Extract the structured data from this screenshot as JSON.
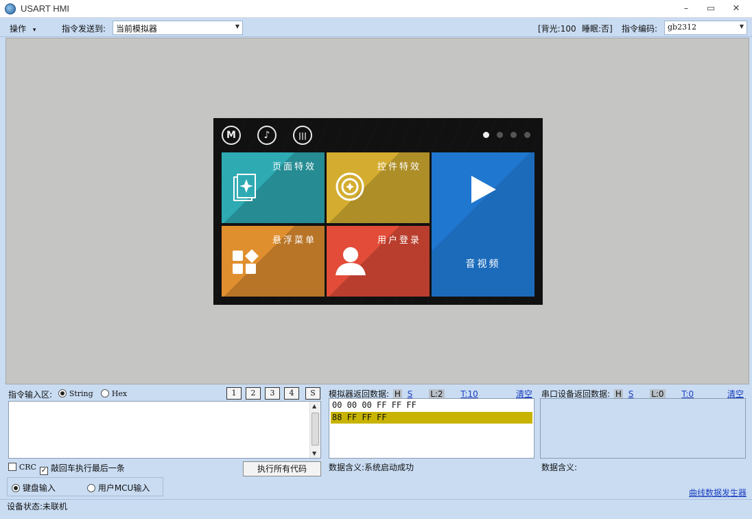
{
  "window": {
    "title": "USART HMI",
    "minimize": "–",
    "maximize": "▭",
    "close": "✕"
  },
  "toolbar": {
    "menu_label": "操作",
    "menu_arrow": "▾",
    "send_to_label": "指令发送到:",
    "send_to_value": "当前模拟器",
    "backlight": "[背光:100",
    "sleep": "睡眠:否]",
    "encoding_label": "指令编码:",
    "encoding_value": "gb2312"
  },
  "hmi_screen": {
    "top_icons": [
      "M",
      "♪",
      "|||"
    ],
    "page_dots": 4,
    "active_dot": 0,
    "tiles": [
      {
        "label": "页面特效",
        "color": "#2eaab3",
        "icon": "page-effect-icon"
      },
      {
        "label": "控件特效",
        "color": "#d4ad30",
        "icon": "control-effect-icon"
      },
      {
        "label": "音视频",
        "color": "#1f77d0",
        "icon": "play-icon"
      },
      {
        "label": "悬浮菜单",
        "color": "#e08f2f",
        "icon": "menu-blocks-icon"
      },
      {
        "label": "用户登录",
        "color": "#e24c38",
        "icon": "user-icon"
      }
    ]
  },
  "input_panel": {
    "title": "指令输入区:",
    "mode_string": "String",
    "mode_hex": "Hex",
    "slot_buttons": [
      "1",
      "2",
      "3",
      "4",
      "S"
    ],
    "crc_label": "CRC",
    "enter_exec_label": "敲回车执行最后一条",
    "exec_all_button": "执行所有代码",
    "keyboard_input": "键盘输入",
    "mcu_input": "用户MCU输入"
  },
  "sim_panel": {
    "title": "模拟器返回数据:",
    "h": "H",
    "s": "S",
    "length": "L:2",
    "time": "T:10",
    "clear": "清空",
    "lines": [
      "00 00 00 FF FF FF",
      "88 FF FF FF"
    ],
    "meaning": "数据含义:系统启动成功"
  },
  "serial_panel": {
    "title": "串口设备返回数据:",
    "h": "H",
    "s": "S",
    "length": "L:0",
    "time": "T:0",
    "clear": "清空",
    "meaning": "数据含义:"
  },
  "curve_link": "曲线数据发生器",
  "status": "设备状态:未联机"
}
